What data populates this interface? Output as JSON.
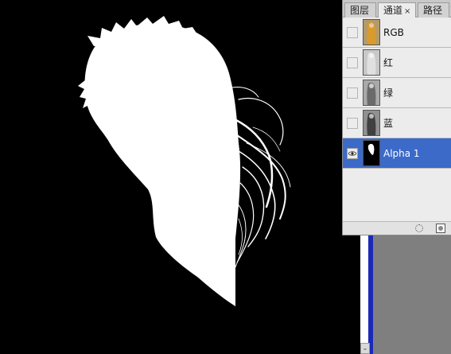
{
  "colors": {
    "canvas_bg": "#000000",
    "mask": "#ffffff",
    "selection": "#3b6ac9",
    "panel_bg": "#ececec",
    "workspace": "#7f7f7f",
    "window_border_blue": "#1b2ab6"
  },
  "panel": {
    "tabs": [
      {
        "label": "图层",
        "active": false
      },
      {
        "label": "通道",
        "active": true,
        "close_glyph": "×"
      },
      {
        "label": "路径",
        "active": false
      }
    ],
    "channels": [
      {
        "label": "RGB",
        "visible": false,
        "selected": false,
        "thumb": "color-photo-thumb"
      },
      {
        "label": "红",
        "visible": false,
        "selected": false,
        "thumb": "gray-photo-thumb"
      },
      {
        "label": "绿",
        "visible": false,
        "selected": false,
        "thumb": "gray-photo-thumb"
      },
      {
        "label": "蓝",
        "visible": false,
        "selected": false,
        "thumb": "gray-photo-thumb"
      },
      {
        "label": "Alpha 1",
        "visible": true,
        "selected": true,
        "thumb": "mask-thumb"
      }
    ],
    "footer_icons": [
      "load-selection-icon",
      "save-selection-icon"
    ]
  },
  "scrollbar": {
    "down_arrow": "⌄"
  }
}
